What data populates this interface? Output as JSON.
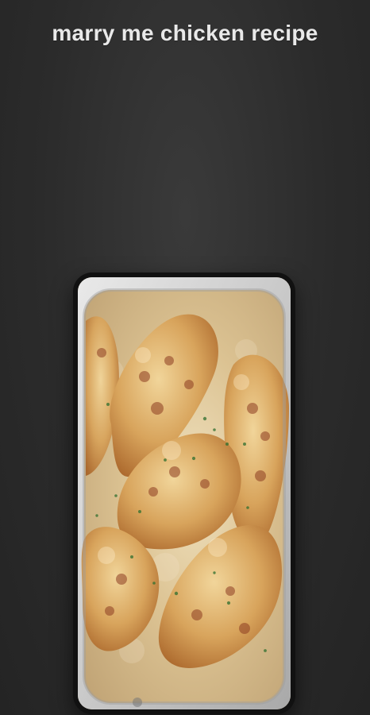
{
  "app": {
    "title": "marry me chicken recipe"
  },
  "hero_image": {
    "icon": "recipe-photo-icon"
  },
  "colors": {
    "background": "#2f2f2f",
    "title_text": "#e9e9e9",
    "frame": "#111111"
  }
}
